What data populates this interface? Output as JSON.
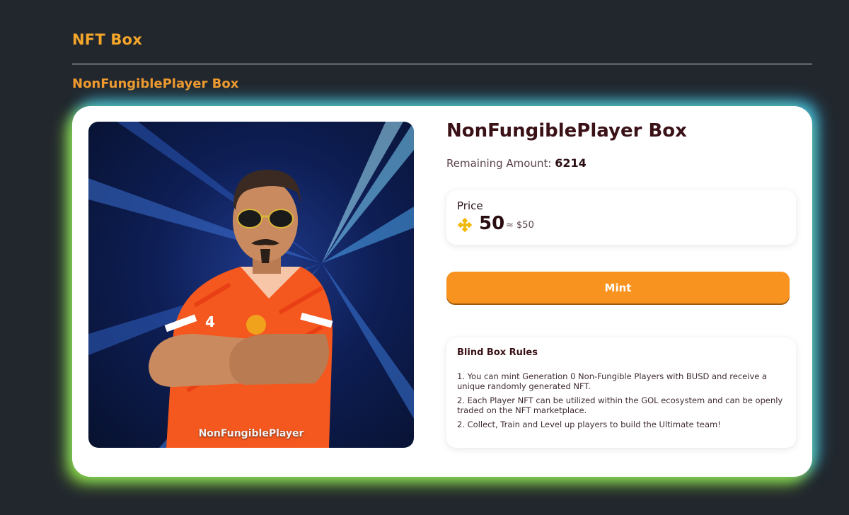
{
  "header": {
    "title": "NFT Box"
  },
  "section": {
    "title": "NonFungiblePlayer Box"
  },
  "product": {
    "image_caption": "NonFungiblePlayer",
    "title": "NonFungiblePlayer Box",
    "remaining_label": "Remaining Amount:",
    "remaining_value": "6214",
    "price": {
      "label": "Price",
      "icon": "bnb-coin-icon",
      "value": "50",
      "usd_equivalent": "≈ $50"
    },
    "mint_label": "Mint",
    "rules": {
      "title": "Blind Box Rules",
      "items": [
        "1. You can mint Generation 0 Non-Fungible Players with BUSD and receive a unique randomly generated NFT.",
        "2. Each Player NFT can be utilized within the GOL ecosystem and can be openly traded on the NFT marketplace.",
        "2. Collect, Train and Level up players to build the Ultimate team!"
      ]
    }
  },
  "colors": {
    "background": "#22272e",
    "title_accent": "#f4a62a",
    "mint_button": "#f7931e",
    "dark_text": "#3a1116"
  }
}
